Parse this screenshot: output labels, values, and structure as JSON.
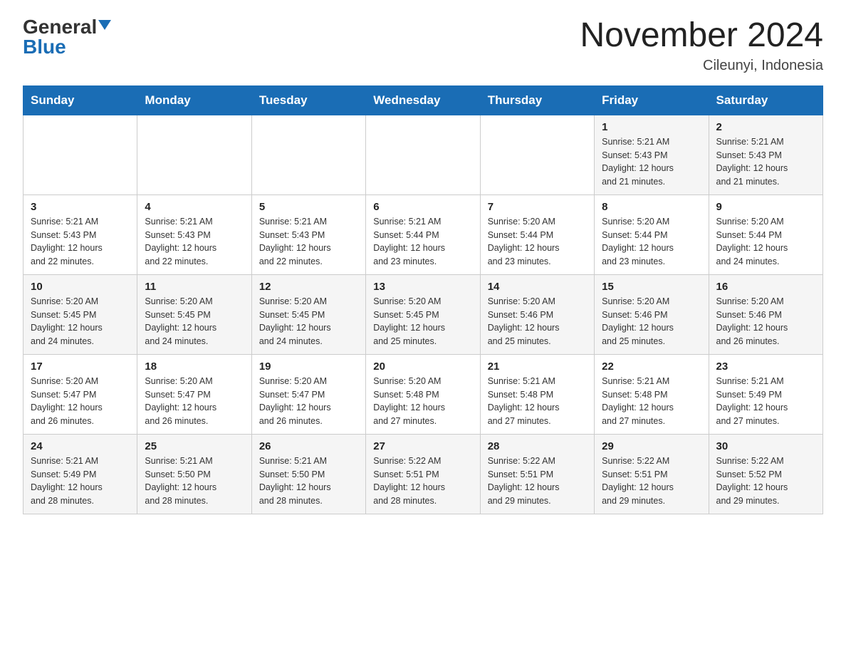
{
  "header": {
    "logo_general": "General",
    "logo_blue": "Blue",
    "month_title": "November 2024",
    "location": "Cileunyi, Indonesia"
  },
  "days_of_week": [
    "Sunday",
    "Monday",
    "Tuesday",
    "Wednesday",
    "Thursday",
    "Friday",
    "Saturday"
  ],
  "weeks": [
    [
      {
        "day": "",
        "info": ""
      },
      {
        "day": "",
        "info": ""
      },
      {
        "day": "",
        "info": ""
      },
      {
        "day": "",
        "info": ""
      },
      {
        "day": "",
        "info": ""
      },
      {
        "day": "1",
        "info": "Sunrise: 5:21 AM\nSunset: 5:43 PM\nDaylight: 12 hours\nand 21 minutes."
      },
      {
        "day": "2",
        "info": "Sunrise: 5:21 AM\nSunset: 5:43 PM\nDaylight: 12 hours\nand 21 minutes."
      }
    ],
    [
      {
        "day": "3",
        "info": "Sunrise: 5:21 AM\nSunset: 5:43 PM\nDaylight: 12 hours\nand 22 minutes."
      },
      {
        "day": "4",
        "info": "Sunrise: 5:21 AM\nSunset: 5:43 PM\nDaylight: 12 hours\nand 22 minutes."
      },
      {
        "day": "5",
        "info": "Sunrise: 5:21 AM\nSunset: 5:43 PM\nDaylight: 12 hours\nand 22 minutes."
      },
      {
        "day": "6",
        "info": "Sunrise: 5:21 AM\nSunset: 5:44 PM\nDaylight: 12 hours\nand 23 minutes."
      },
      {
        "day": "7",
        "info": "Sunrise: 5:20 AM\nSunset: 5:44 PM\nDaylight: 12 hours\nand 23 minutes."
      },
      {
        "day": "8",
        "info": "Sunrise: 5:20 AM\nSunset: 5:44 PM\nDaylight: 12 hours\nand 23 minutes."
      },
      {
        "day": "9",
        "info": "Sunrise: 5:20 AM\nSunset: 5:44 PM\nDaylight: 12 hours\nand 24 minutes."
      }
    ],
    [
      {
        "day": "10",
        "info": "Sunrise: 5:20 AM\nSunset: 5:45 PM\nDaylight: 12 hours\nand 24 minutes."
      },
      {
        "day": "11",
        "info": "Sunrise: 5:20 AM\nSunset: 5:45 PM\nDaylight: 12 hours\nand 24 minutes."
      },
      {
        "day": "12",
        "info": "Sunrise: 5:20 AM\nSunset: 5:45 PM\nDaylight: 12 hours\nand 24 minutes."
      },
      {
        "day": "13",
        "info": "Sunrise: 5:20 AM\nSunset: 5:45 PM\nDaylight: 12 hours\nand 25 minutes."
      },
      {
        "day": "14",
        "info": "Sunrise: 5:20 AM\nSunset: 5:46 PM\nDaylight: 12 hours\nand 25 minutes."
      },
      {
        "day": "15",
        "info": "Sunrise: 5:20 AM\nSunset: 5:46 PM\nDaylight: 12 hours\nand 25 minutes."
      },
      {
        "day": "16",
        "info": "Sunrise: 5:20 AM\nSunset: 5:46 PM\nDaylight: 12 hours\nand 26 minutes."
      }
    ],
    [
      {
        "day": "17",
        "info": "Sunrise: 5:20 AM\nSunset: 5:47 PM\nDaylight: 12 hours\nand 26 minutes."
      },
      {
        "day": "18",
        "info": "Sunrise: 5:20 AM\nSunset: 5:47 PM\nDaylight: 12 hours\nand 26 minutes."
      },
      {
        "day": "19",
        "info": "Sunrise: 5:20 AM\nSunset: 5:47 PM\nDaylight: 12 hours\nand 26 minutes."
      },
      {
        "day": "20",
        "info": "Sunrise: 5:20 AM\nSunset: 5:48 PM\nDaylight: 12 hours\nand 27 minutes."
      },
      {
        "day": "21",
        "info": "Sunrise: 5:21 AM\nSunset: 5:48 PM\nDaylight: 12 hours\nand 27 minutes."
      },
      {
        "day": "22",
        "info": "Sunrise: 5:21 AM\nSunset: 5:48 PM\nDaylight: 12 hours\nand 27 minutes."
      },
      {
        "day": "23",
        "info": "Sunrise: 5:21 AM\nSunset: 5:49 PM\nDaylight: 12 hours\nand 27 minutes."
      }
    ],
    [
      {
        "day": "24",
        "info": "Sunrise: 5:21 AM\nSunset: 5:49 PM\nDaylight: 12 hours\nand 28 minutes."
      },
      {
        "day": "25",
        "info": "Sunrise: 5:21 AM\nSunset: 5:50 PM\nDaylight: 12 hours\nand 28 minutes."
      },
      {
        "day": "26",
        "info": "Sunrise: 5:21 AM\nSunset: 5:50 PM\nDaylight: 12 hours\nand 28 minutes."
      },
      {
        "day": "27",
        "info": "Sunrise: 5:22 AM\nSunset: 5:51 PM\nDaylight: 12 hours\nand 28 minutes."
      },
      {
        "day": "28",
        "info": "Sunrise: 5:22 AM\nSunset: 5:51 PM\nDaylight: 12 hours\nand 29 minutes."
      },
      {
        "day": "29",
        "info": "Sunrise: 5:22 AM\nSunset: 5:51 PM\nDaylight: 12 hours\nand 29 minutes."
      },
      {
        "day": "30",
        "info": "Sunrise: 5:22 AM\nSunset: 5:52 PM\nDaylight: 12 hours\nand 29 minutes."
      }
    ]
  ]
}
